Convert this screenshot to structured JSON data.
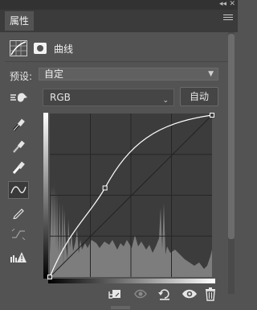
{
  "panel": {
    "tab_label": "属性",
    "title": "曲线",
    "preset_label": "预设:",
    "preset_value": "自定",
    "channel_value": "RGB",
    "auto_label": "自动"
  },
  "icons": {
    "collapse": "double-chevron-icon",
    "close": "close-icon",
    "menu": "hamburger-menu-icon",
    "curves": "curves-adjustment-icon",
    "mask": "layer-mask-icon",
    "hand": "on-image-adjust-hand-icon",
    "black_point": "black-point-eyedropper-icon",
    "gray_point": "gray-point-eyedropper-icon",
    "white_point": "white-point-eyedropper-icon",
    "curve_tool": "curve-point-tool-icon",
    "pencil": "pencil-draw-icon",
    "smooth": "smooth-curve-icon",
    "clipping": "clipping-warning-icon",
    "clip_layer": "clip-to-layer-icon",
    "view_previous": "view-previous-state-icon",
    "reset": "reset-icon",
    "visibility": "eye-visibility-icon",
    "delete": "trash-icon"
  },
  "curve": {
    "points": [
      [
        0,
        0
      ],
      [
        0.34,
        0.55
      ],
      [
        1,
        1
      ]
    ]
  }
}
